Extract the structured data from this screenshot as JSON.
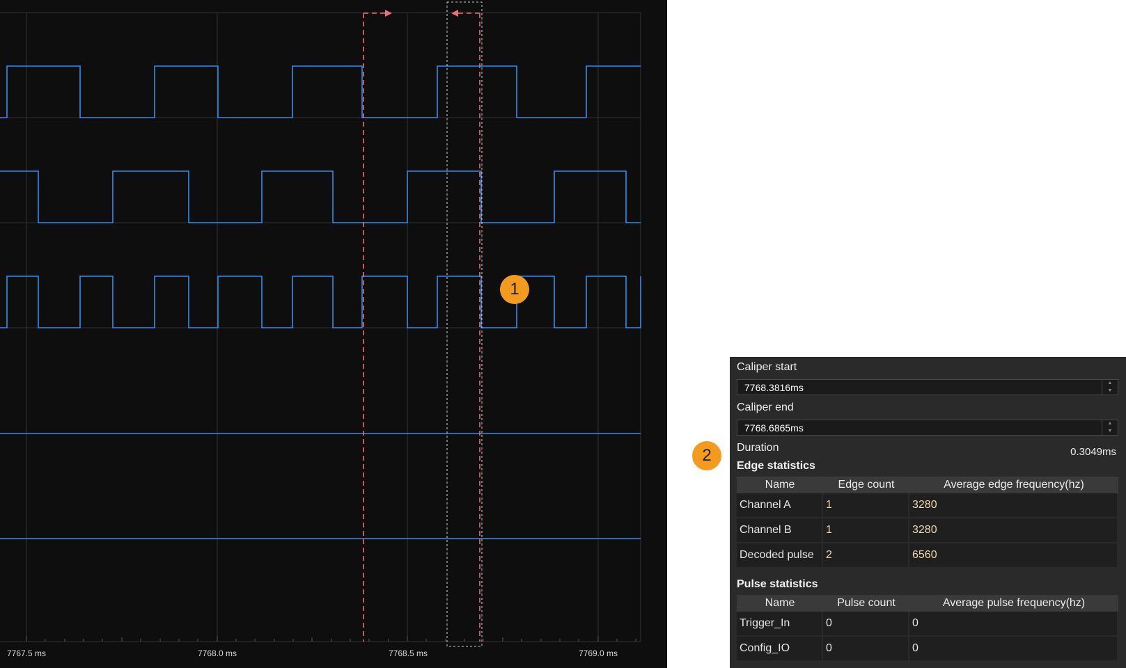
{
  "scope": {
    "time_ticks": [
      "7767.5 ms",
      "7768.0 ms",
      "7768.5 ms",
      "7769.0 ms"
    ],
    "colors": {
      "background": "#0e0e0e",
      "trace": "#2f8ef0",
      "grid": "#3a3a3a",
      "caliper": "#f07070"
    }
  },
  "badges": {
    "one": "1",
    "two": "2"
  },
  "caliper": {
    "start_label": "Caliper start",
    "start_value": "7768.3816ms",
    "end_label": "Caliper end",
    "end_value": "7768.6865ms",
    "duration_label": "Duration",
    "duration_value": "0.3049ms"
  },
  "edge_statistics": {
    "title": "Edge statistics",
    "headers": [
      "Name",
      "Edge count",
      "Average edge frequency(hz)"
    ],
    "rows": [
      [
        "Channel A",
        "1",
        "3280"
      ],
      [
        "Channel B",
        "1",
        "3280"
      ],
      [
        "Decoded pulse",
        "2",
        "6560"
      ]
    ]
  },
  "pulse_statistics": {
    "title": "Pulse statistics",
    "headers": [
      "Name",
      "Pulse count",
      "Average pulse frequency(hz)"
    ],
    "rows": [
      [
        "Trigger_In",
        "0",
        "0"
      ],
      [
        "Config_IO",
        "0",
        "0"
      ]
    ]
  }
}
